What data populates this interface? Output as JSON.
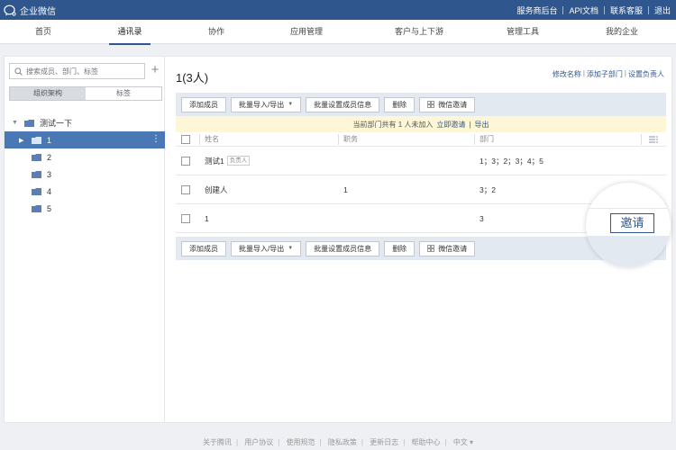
{
  "app": {
    "name": "企业微信"
  },
  "top_links": [
    "服务商后台",
    "API文档",
    "联系客服",
    "退出"
  ],
  "nav": {
    "items": [
      "首页",
      "通讯录",
      "协作",
      "应用管理",
      "客户与上下游",
      "管理工具",
      "我的企业"
    ],
    "active_index": 1
  },
  "sidebar": {
    "search_placeholder": "搜索成员、部门、标签",
    "tabs": [
      "组织架构",
      "标签"
    ],
    "active_tab": 0,
    "root": "测试一下",
    "children": [
      "1",
      "2",
      "3",
      "4",
      "5"
    ],
    "selected_child": 0
  },
  "main": {
    "title": "1(3人)",
    "links": [
      "修改名称",
      "添加子部门",
      "设置负责人"
    ],
    "toolbar": {
      "add_member": "添加成员",
      "batch_import": "批量导入/导出",
      "batch_set": "批量设置成员信息",
      "delete": "删除",
      "wechat_invite": "微信邀请"
    },
    "notice": {
      "text": "当前部门共有 1 人未加入",
      "invite_link": "立即邀请",
      "sep": "|",
      "export_link": "导出"
    },
    "table": {
      "columns": [
        "姓名",
        "职务",
        "部门"
      ],
      "rows": [
        {
          "name": "测试1",
          "badge": "负责人",
          "title": "",
          "dept": "1；3；2；3；4；5"
        },
        {
          "name": "创建人",
          "badge": "",
          "title": "1",
          "dept": "3；2"
        },
        {
          "name": "1",
          "badge": "",
          "title": "",
          "dept": "3"
        }
      ]
    },
    "invite_button": "邀请"
  },
  "footer": [
    "关于腾讯",
    "用户协议",
    "使用规范",
    "隐私政策",
    "更新日志",
    "帮助中心",
    "中文 ▾"
  ],
  "colors": {
    "topbar": "#2f578e",
    "accent": "#2f578e",
    "selected_row": "#4a78b4",
    "toolbar_bg": "#e3e9f1",
    "notice_bg": "#fdf6d7"
  }
}
